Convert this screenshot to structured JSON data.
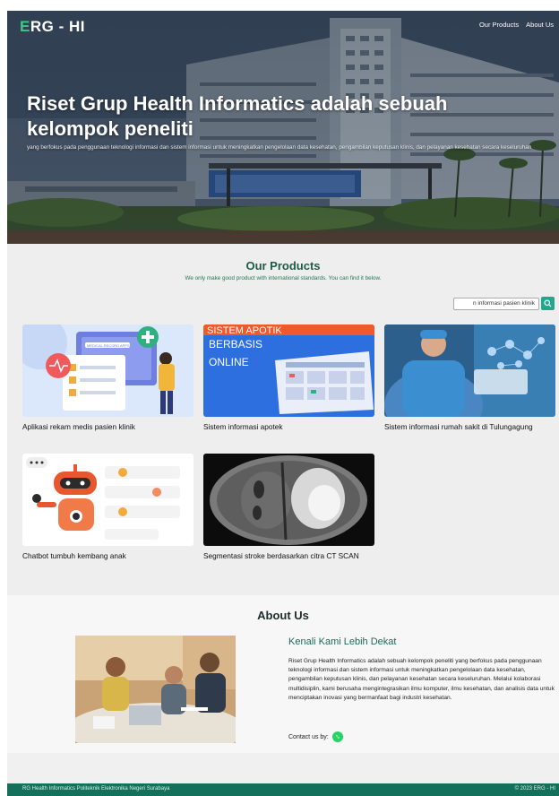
{
  "header": {
    "brand_prefix": "E",
    "brand_rest": "RG - HI",
    "nav": [
      "Our Products",
      "About Us"
    ]
  },
  "hero": {
    "title": "Riset Grup Health Informatics adalah sebuah kelompok peneliti",
    "subtitle": "yang berfokus pada penggunaan teknologi informasi dan sistem informasi untuk meningkatkan pengelolaan data kesehatan, pengambilan keputusan klinis, dan pelayanan kesehatan secara keseluruhan"
  },
  "products": {
    "heading": "Our Products",
    "tagline": "We only make good product with international standards. You can find it below.",
    "search_value": "n informasi pasien klinik",
    "items": [
      {
        "title": "Aplikasi rekam medis pasien klinik",
        "image_text": "MEDICAL RECORD APPS"
      },
      {
        "title": "Sistem informasi apotek",
        "image_text_1": "SISTEM APOTIK",
        "image_text_2": "BERBASIS",
        "image_text_3": "ONLINE"
      },
      {
        "title": "Sistem informasi rumah sakit di Tulungagung"
      },
      {
        "title": "Chatbot tumbuh kembang anak"
      },
      {
        "title": "Segmentasi stroke berdasarkan citra CT SCAN"
      }
    ]
  },
  "about": {
    "heading": "About Us",
    "subheading": "Kenali Kami Lebih Dekat",
    "body": "Riset Grup Health Informatics adalah sebuah kelompok peneliti yang berfokus pada penggunaan teknologi informasi dan sistem informasi untuk meningkatkan pengelolaan data kesehatan, pengambilan keputusan klinis, dan pelayanan kesehatan secara keseluruhan. Melalui kolaborasi multidisiplin, kami berusaha mengintegrasikan ilmu komputer, ilmu kesehatan, dan analisis data untuk menciptakan inovasi yang bermanfaat bagi industri kesehatan.",
    "contact_label": "Contact us by:",
    "contact_icon": "whatsapp-icon"
  },
  "footer": {
    "left": "RG Health Informatics Politeknik Elektronika Negeri Surabaya",
    "right": "© 2023 ERG - HI"
  },
  "colors": {
    "accent": "#1fa98a",
    "heading_green": "#1c5c47",
    "footer": "#14705a"
  }
}
